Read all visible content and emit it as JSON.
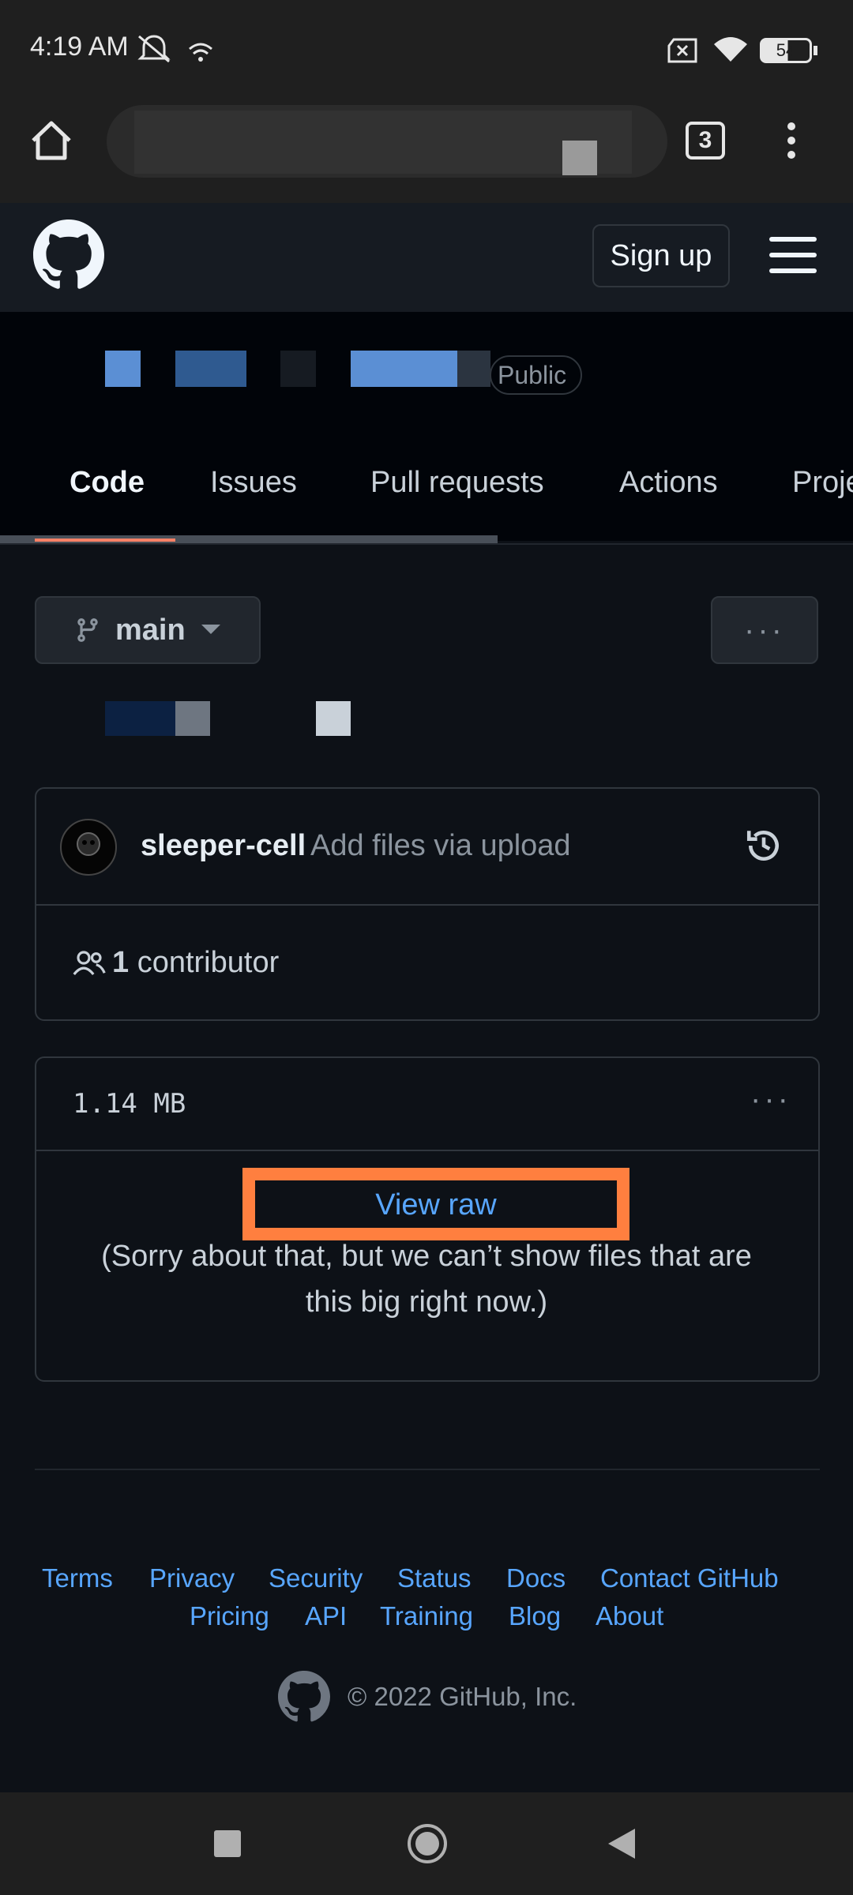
{
  "status_bar": {
    "time": "4:19 AM",
    "battery": "54"
  },
  "browser": {
    "tab_count": "3"
  },
  "header": {
    "signup_label": "Sign up"
  },
  "repo": {
    "visibility_badge": "Public"
  },
  "tabs": [
    {
      "label": "Code",
      "active": true
    },
    {
      "label": "Issues"
    },
    {
      "label": "Pull requests"
    },
    {
      "label": "Actions"
    },
    {
      "label": "Proje"
    }
  ],
  "branch": {
    "name": "main",
    "more_label": "···"
  },
  "commit": {
    "author": "sleeper-cell",
    "message": "Add files via upload",
    "contributors_count": "1",
    "contributors_label": "contributor"
  },
  "file": {
    "size": "1.14 MB",
    "view_raw": "View raw",
    "message": "(Sorry about that, but we can’t show files that are this big right now.)"
  },
  "footer": {
    "row1": [
      "Terms",
      "Privacy",
      "Security",
      "Status",
      "Docs",
      "Contact GitHub"
    ],
    "row2": [
      "Pricing",
      "API",
      "Training",
      "Blog",
      "About"
    ],
    "copyright": "© 2022 GitHub, Inc."
  },
  "colors": {
    "accent_link": "#58a6ff",
    "highlight": "#ff7f3f",
    "tab_underline": "#f78166"
  }
}
